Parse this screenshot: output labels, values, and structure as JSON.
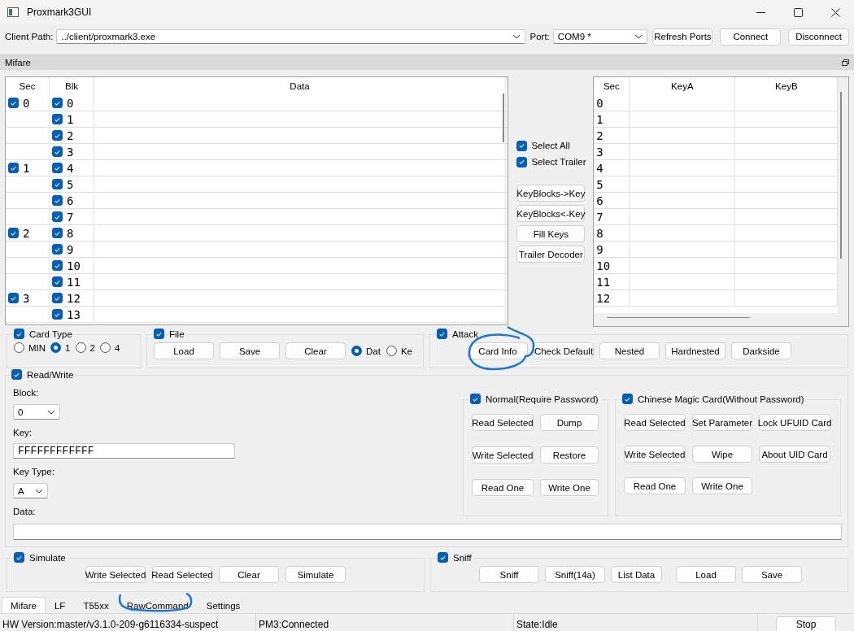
{
  "window": {
    "title": "Proxmark3GUI"
  },
  "toolbar": {
    "client_path_label": "Client Path:",
    "client_path": "../client/proxmark3.exe",
    "port_label": "Port:",
    "port": "COM9 *",
    "buttons": [
      "Refresh Ports",
      "Connect",
      "Disconnect"
    ]
  },
  "dock": {
    "title": "Mifare"
  },
  "data_table": {
    "columns": [
      "Sec",
      "Blk",
      "Data"
    ],
    "rows": [
      {
        "sec": "0",
        "sec_checked": true,
        "blk": "0",
        "blk_checked": true
      },
      {
        "blk": "1",
        "blk_checked": true
      },
      {
        "blk": "2",
        "blk_checked": true
      },
      {
        "blk": "3",
        "blk_checked": true
      },
      {
        "sec": "1",
        "sec_checked": true,
        "blk": "4",
        "blk_checked": true
      },
      {
        "blk": "5",
        "blk_checked": true
      },
      {
        "blk": "6",
        "blk_checked": true
      },
      {
        "blk": "7",
        "blk_checked": true
      },
      {
        "sec": "2",
        "sec_checked": true,
        "blk": "8",
        "blk_checked": true
      },
      {
        "blk": "9",
        "blk_checked": true
      },
      {
        "blk": "10",
        "blk_checked": true
      },
      {
        "blk": "11",
        "blk_checked": true
      },
      {
        "sec": "3",
        "sec_checked": true,
        "blk": "12",
        "blk_checked": true
      },
      {
        "blk": "13",
        "blk_checked": true
      }
    ]
  },
  "select": [
    {
      "label": "Select All",
      "checked": true
    },
    {
      "label": "Select Trailer",
      "checked": true
    }
  ],
  "key_buttons": [
    "KeyBlocks->Key",
    "KeyBlocks<-Key",
    "Fill Keys",
    "Trailer Decoder"
  ],
  "key_table": {
    "columns": [
      "Sec",
      "KeyA",
      "KeyB"
    ],
    "rows": [
      "0",
      "1",
      "2",
      "3",
      "4",
      "5",
      "6",
      "7",
      "8",
      "9",
      "10",
      "11",
      "12"
    ]
  },
  "card_type": {
    "title": "Card Type",
    "checked": true,
    "options": [
      {
        "label": "MIN",
        "selected": false
      },
      {
        "label": "1",
        "selected": true
      },
      {
        "label": "2",
        "selected": false
      },
      {
        "label": "4",
        "selected": false
      }
    ]
  },
  "file": {
    "title": "File",
    "checked": true,
    "buttons": [
      "Load",
      "Save",
      "Clear"
    ],
    "options": [
      {
        "label": "Dat",
        "selected": true
      },
      {
        "label": "Ke",
        "selected": false
      }
    ]
  },
  "attack": {
    "title": "Attack",
    "checked": true,
    "buttons": [
      "Card Info",
      "Check Default",
      "Nested",
      "Hardnested",
      "Darkside"
    ]
  },
  "read_write": {
    "title": "Read/Write",
    "checked": true,
    "block_label": "Block:",
    "block": "0",
    "key_label": "Key:",
    "key": "FFFFFFFFFFFF",
    "key_type_label": "Key Type:",
    "key_type": "A",
    "data_label": "Data:",
    "normal": {
      "title": "Normal(Require Password)",
      "checked": true,
      "buttons": [
        "Read Selected",
        "Dump",
        "Write Selected",
        "Restore",
        "Read One",
        "Write One"
      ]
    },
    "magic": {
      "title": "Chinese Magic Card(Without Password)",
      "checked": true,
      "buttons": [
        "Read Selected",
        "Set Parameter",
        "Lock UFUID Card",
        "Write Selected",
        "Wipe",
        "About UID Card",
        "Read One",
        "Write One"
      ]
    }
  },
  "simulate": {
    "title": "Simulate",
    "checked": true,
    "buttons": [
      "Write Selected",
      "Read Selected",
      "Clear",
      "Simulate"
    ]
  },
  "sniff": {
    "title": "Sniff",
    "checked": true,
    "buttons": [
      "Sniff",
      "Sniff(14a)",
      "List Data",
      "Load",
      "Save"
    ]
  },
  "tabs": [
    {
      "label": "Mifare",
      "selected": true
    },
    {
      "label": "LF",
      "selected": false
    },
    {
      "label": "T55xx",
      "selected": false
    },
    {
      "label": "RawCommand",
      "selected": false
    },
    {
      "label": "Settings",
      "selected": false
    }
  ],
  "status_bar": [
    "HW Version:master/v3.1.0-209-g6116334-suspect",
    "PM3:Connected",
    "State:Idle"
  ],
  "stop_button": "Stop"
}
